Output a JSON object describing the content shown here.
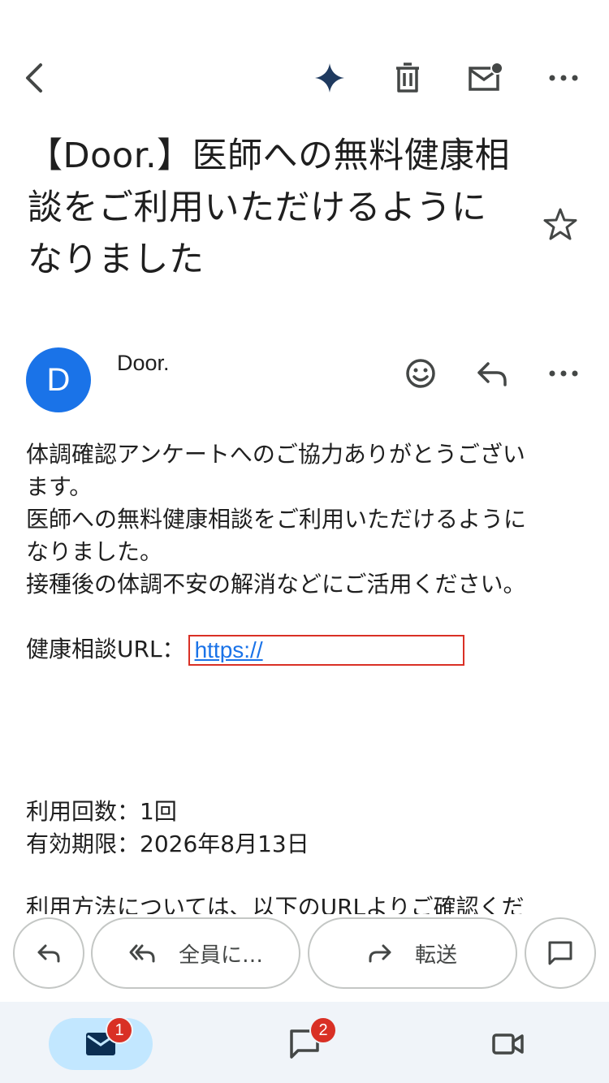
{
  "subject": {
    "line1": "【Door.】医師への無料健康相",
    "line2": "談をご利用いただけるように",
    "line3": "なりました"
  },
  "sender": {
    "avatar_initial": "D",
    "name": "Door."
  },
  "body": {
    "line1": "体調確認アンケートへのご協力ありがとうござい",
    "line2": "ます。",
    "line3": "医師への無料健康相談をご利用いただけるように",
    "line4": "なりました。",
    "line5": "接種後の体調不安の解消などにご活用ください。",
    "url_label": "健康相談URL：",
    "url_link": "https://",
    "usage_count": "利用回数：1回",
    "expiry": "有効期限：2026年8月13日",
    "cutoff_line": "利用方法については、以下のURLよりご確認くだ"
  },
  "actions": {
    "reply_all_label": "全員に…",
    "forward_label": "転送"
  },
  "nav": {
    "mail_badge": "1",
    "chat_badge": "2"
  },
  "colors": {
    "accent": "#1a73e8",
    "badge": "#d93025",
    "nav_bg": "#f0f4f9",
    "nav_active": "#c2e7ff",
    "link_highlight": "#d93025"
  },
  "icons": [
    "back-arrow-icon",
    "gemini-sparkle-icon",
    "trash-icon",
    "mark-unread-icon",
    "more-vert-icon",
    "star-icon",
    "emoji-icon",
    "reply-icon",
    "reply-all-icon",
    "forward-icon",
    "chat-bubble-icon",
    "mail-icon",
    "video-icon"
  ]
}
